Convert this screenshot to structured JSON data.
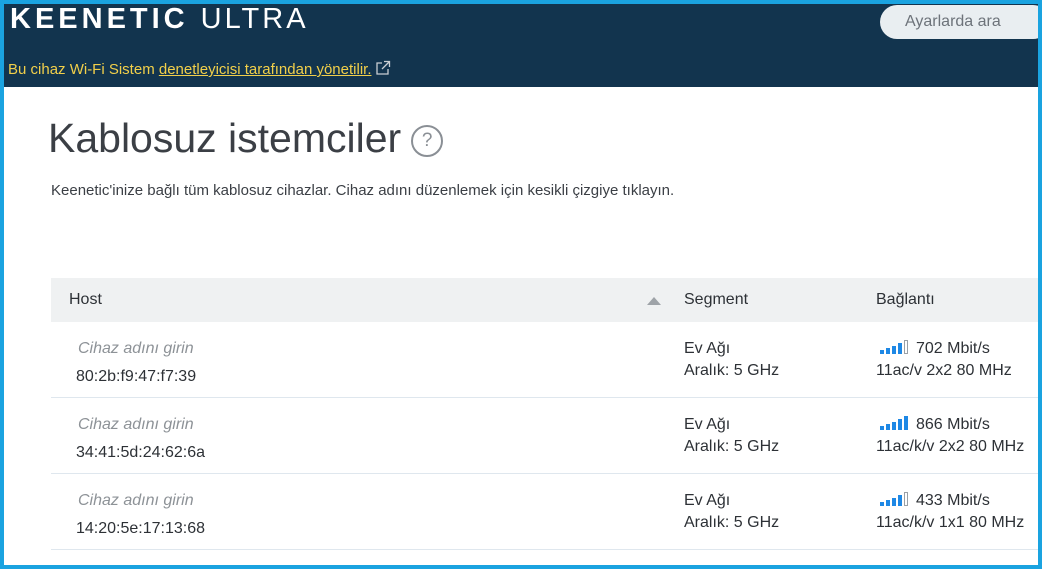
{
  "header": {
    "brand": "KEENETIC",
    "model": "ULTRA",
    "search_placeholder": "Ayarlarda ara",
    "notice_text": "Bu cihaz Wi-Fi Sistem ",
    "notice_link": "denetleyicisi tarafından yönetilir."
  },
  "page": {
    "title": "Kablosuz istemciler",
    "help_symbol": "?",
    "description": "Keenetic'inize bağlı tüm kablosuz cihazlar. Cihaz adını düzenlemek için kesikli çizgiye tıklayın."
  },
  "table": {
    "columns": {
      "host": "Host",
      "segment": "Segment",
      "connection": "Bağlantı"
    },
    "rows": [
      {
        "host_placeholder": "Cihaz adını girin",
        "mac": "80:2b:f9:47:f7:39",
        "segment": "Ev Ağı",
        "band": "Aralık: 5 GHz",
        "signal_bars": 4,
        "speed": "702 Mbit/s",
        "mode": "11ac/v 2x2 80 MHz"
      },
      {
        "host_placeholder": "Cihaz adını girin",
        "mac": "34:41:5d:24:62:6a",
        "segment": "Ev Ağı",
        "band": "Aralık: 5 GHz",
        "signal_bars": 5,
        "speed": "866 Mbit/s",
        "mode": "11ac/k/v 2x2 80 MHz"
      },
      {
        "host_placeholder": "Cihaz adını girin",
        "mac": "14:20:5e:17:13:68",
        "segment": "Ev Ağı",
        "band": "Aralık: 5 GHz",
        "signal_bars": 4,
        "speed": "433 Mbit/s",
        "mode": "11ac/k/v 1x1 80 MHz"
      }
    ]
  },
  "colors": {
    "header_bg": "#12344e",
    "notice": "#f1cf4a",
    "signal": "#1e88e5",
    "frame_border": "#1aa3e0"
  }
}
